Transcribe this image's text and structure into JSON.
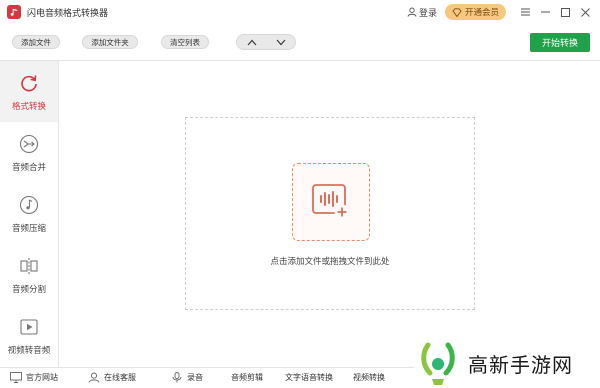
{
  "titlebar": {
    "title": "闪电音频格式转换器",
    "login_label": "登录",
    "vip_label": "开通会员"
  },
  "toolbar": {
    "add_file": "添加文件",
    "add_folder": "添加文件夹",
    "clear_list": "清空列表",
    "start": "开始转换"
  },
  "sidebar": {
    "items": [
      {
        "label": "格式转换",
        "icon": "refresh-icon"
      },
      {
        "label": "音频合并",
        "icon": "merge-icon"
      },
      {
        "label": "音频压缩",
        "icon": "note-icon"
      },
      {
        "label": "音频分割",
        "icon": "split-icon"
      },
      {
        "label": "视频转音频",
        "icon": "play-icon"
      }
    ]
  },
  "main": {
    "drop_text": "点击添加文件或拖拽文件到此处"
  },
  "footer": {
    "site": "官方网站",
    "service": "在线客服",
    "record": "录音",
    "edit": "音频剪辑",
    "tts": "文字语音转换",
    "video": "视频转换"
  },
  "watermark": {
    "text": "高新手游网"
  },
  "colors": {
    "accent": "#d9363e",
    "start": "#21a14a",
    "vip": "#f6c87f",
    "drop": "#e08c6d"
  }
}
